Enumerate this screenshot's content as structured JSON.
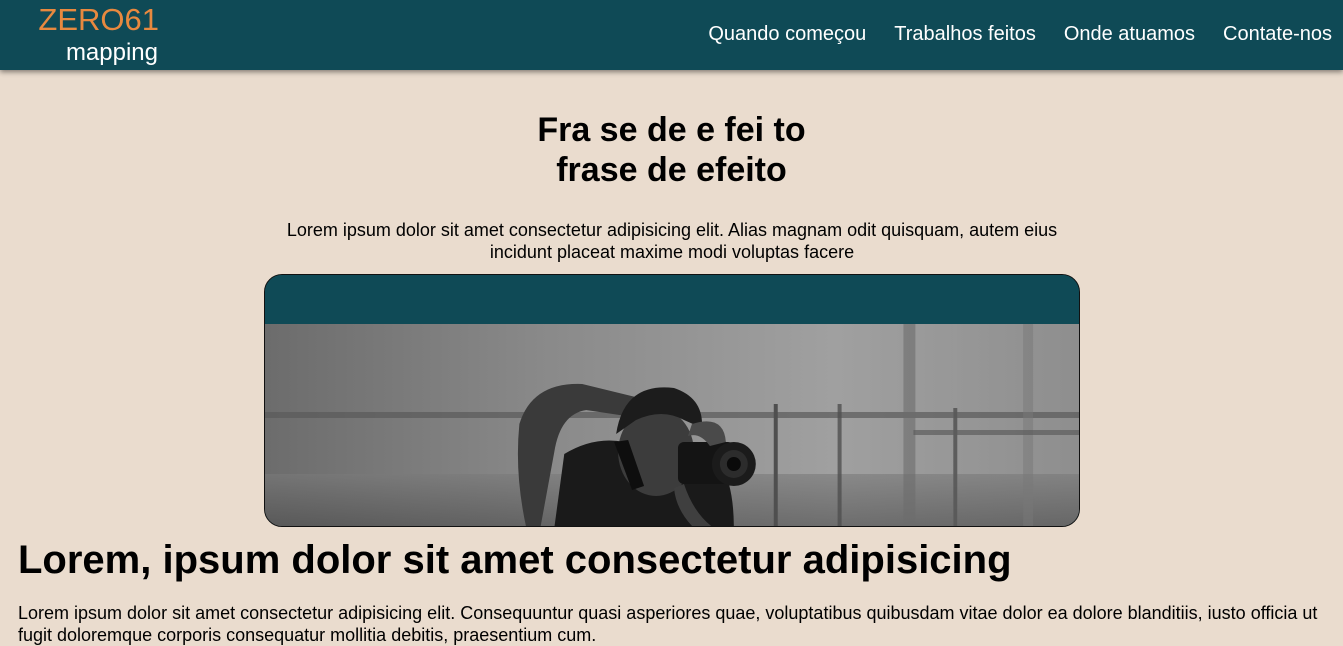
{
  "header": {
    "logo_top": "ZERO61",
    "logo_bottom": "mapping",
    "nav": [
      {
        "label": "Quando começou"
      },
      {
        "label": "Trabalhos feitos"
      },
      {
        "label": "Onde atuamos"
      },
      {
        "label": "Contate-nos"
      }
    ]
  },
  "hero": {
    "title_line1": "Fra se de e fei to",
    "title_line2": "frase de efeito",
    "text": "Lorem ipsum dolor sit amet consectetur adipisicing elit. Alias magnam odit quisquam, autem eius incidunt placeat maxime modi voluptas facere"
  },
  "section": {
    "title": "Lorem, ipsum dolor sit amet consectetur adipisicing",
    "text": "Lorem ipsum dolor sit amet consectetur adipisicing elit. Consequuntur quasi asperiores quae, voluptatibus quibusdam vitae dolor ea dolore blanditiis, iusto officia ut fugit doloremque corporis consequatur mollitia debitis, praesentium cum."
  },
  "colors": {
    "header_bg": "#0f4a56",
    "logo_accent": "#e8893f",
    "page_bg": "#eadcce"
  }
}
